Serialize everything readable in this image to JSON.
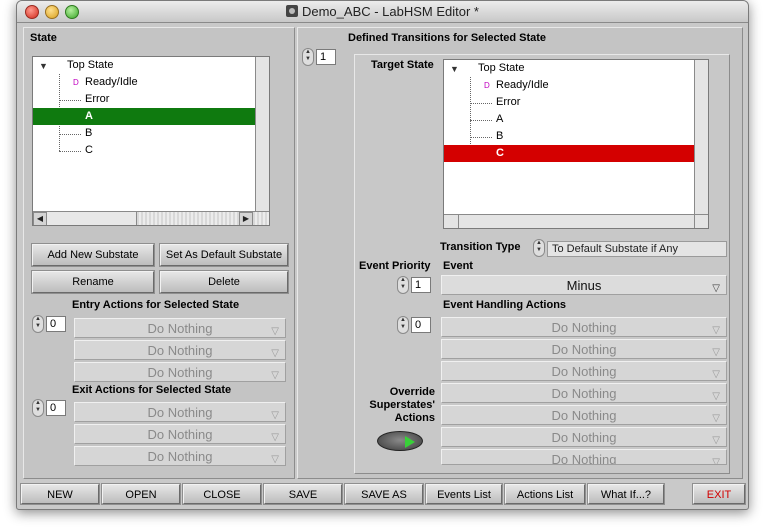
{
  "window": {
    "title": "Demo_ABC - LabHSM Editor *"
  },
  "state_panel": {
    "label": "State",
    "tree": [
      {
        "label": "Top State",
        "level": 0,
        "expander": true
      },
      {
        "label": "Ready/Idle",
        "level": 1,
        "default": true
      },
      {
        "label": "Error",
        "level": 1
      },
      {
        "label": "A",
        "level": 1,
        "selected": true
      },
      {
        "label": "B",
        "level": 1
      },
      {
        "label": "C",
        "level": 1
      }
    ],
    "selected_color": "#0f7a0f",
    "buttons": {
      "add_substate": "Add New Substate",
      "set_default": "Set As Default Substate",
      "rename": "Rename",
      "delete": "Delete"
    },
    "entry_actions": {
      "label": "Entry Actions for Selected State",
      "index": "0",
      "items": [
        "Do Nothing",
        "Do Nothing",
        "Do Nothing"
      ]
    },
    "exit_actions": {
      "label": "Exit Actions for Selected State",
      "index": "0",
      "items": [
        "Do Nothing",
        "Do Nothing",
        "Do Nothing"
      ]
    }
  },
  "transitions_panel": {
    "label": "Defined Transitions for Selected State",
    "index": "1",
    "target_state": {
      "label": "Target State",
      "tree": [
        {
          "label": "Top State",
          "level": 0,
          "expander": true
        },
        {
          "label": "Ready/Idle",
          "level": 1,
          "default": true
        },
        {
          "label": "Error",
          "level": 1
        },
        {
          "label": "A",
          "level": 1
        },
        {
          "label": "B",
          "level": 1
        },
        {
          "label": "C",
          "level": 1,
          "selected": true
        }
      ],
      "selected_color": "#d40000"
    },
    "transition_type": {
      "label": "Transition Type",
      "value": "To Default Substate if Any"
    },
    "event_priority": {
      "label": "Event Priority",
      "value": "1"
    },
    "event": {
      "label": "Event",
      "value": "Minus"
    },
    "event_handling": {
      "label": "Event Handling Actions",
      "index": "0",
      "items": [
        "Do Nothing",
        "Do Nothing",
        "Do Nothing",
        "Do Nothing",
        "Do Nothing",
        "Do Nothing",
        "Do Nothing"
      ]
    },
    "override": {
      "label_line1": "Override",
      "label_line2": "Superstates'",
      "label_line3": "Actions"
    }
  },
  "toolbar": {
    "new": "NEW",
    "open": "OPEN",
    "close": "CLOSE",
    "save": "SAVE",
    "save_as": "SAVE AS",
    "events_list": "Events List",
    "actions_list": "Actions List",
    "what_if": "What If...?",
    "exit": "EXIT"
  },
  "icons": {
    "close": "close-icon",
    "minimize": "minimize-icon",
    "zoom": "zoom-icon",
    "document": "labview-document-icon",
    "expander": "expand-triangle-icon",
    "default_marker": "default-substate-icon",
    "dropdown": "chevron-down-icon",
    "spinner": "spinner-arrows-icon",
    "override_led": "led-toggle-icon"
  }
}
